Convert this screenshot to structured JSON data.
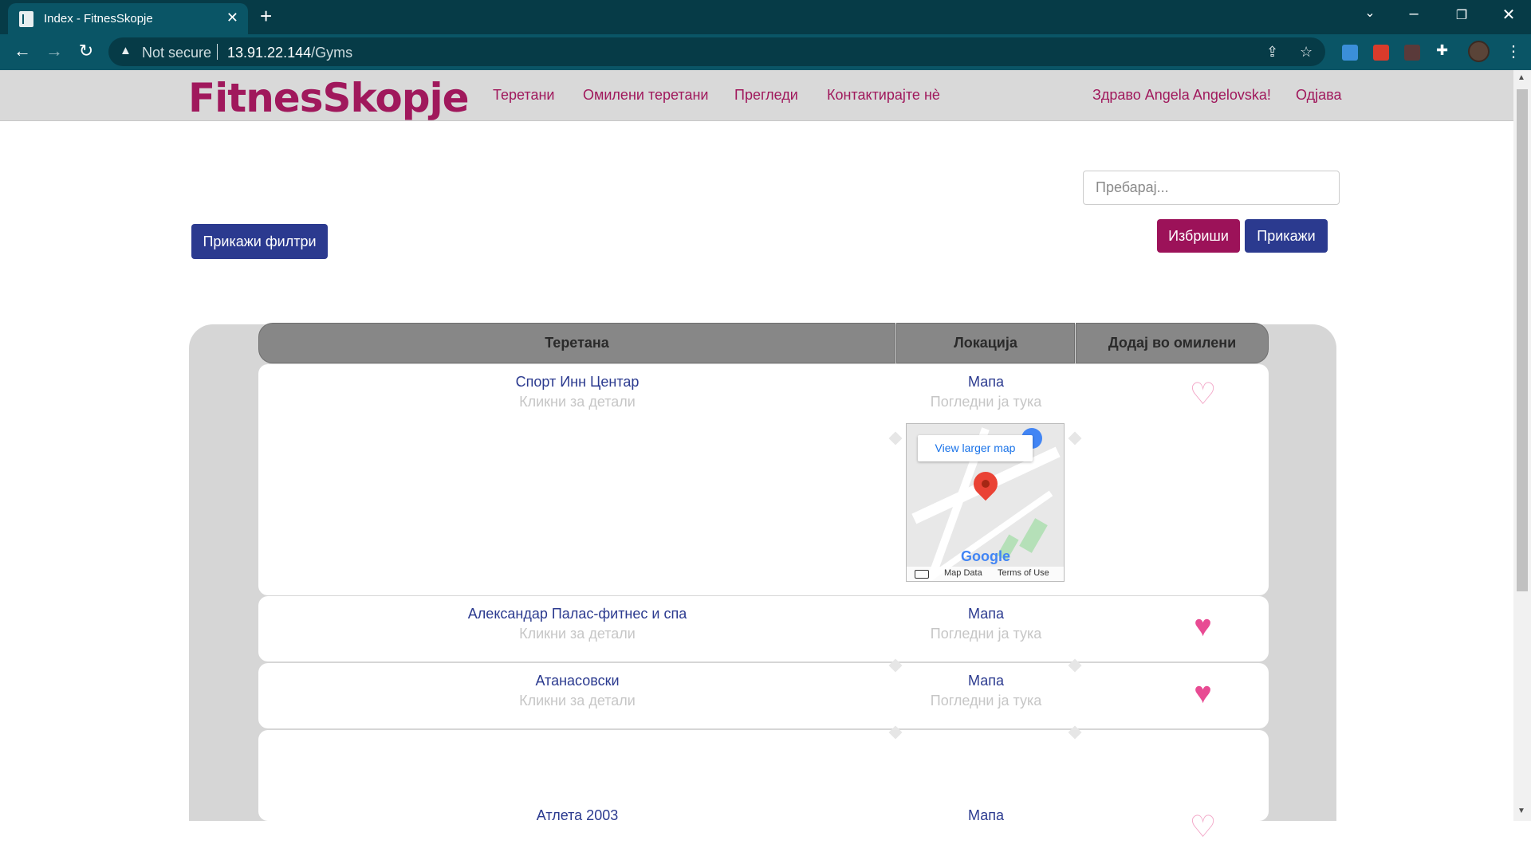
{
  "browser": {
    "tab_title": "Index - FitnesSkopje",
    "new_tab": "+",
    "close": "✕",
    "security": "Not secure",
    "url_host": "13.91.22.144",
    "url_path": "/Gyms"
  },
  "site": {
    "logo": "FitnesSkopje",
    "nav": [
      "Теретани",
      "Омилени теретани",
      "Прегледи",
      "Контактирајте нè"
    ],
    "greeting": "Здраво Angela Angelovska!",
    "logout": "Одјава"
  },
  "search": {
    "placeholder": "Пребарај...",
    "delete_label": "Избриши",
    "show_label": "Прикажи",
    "filters_label": "Прикажи филтри"
  },
  "table": {
    "headers": [
      "Теретана",
      "Локација",
      "Додај во омилени"
    ],
    "rows": [
      {
        "name": "Спорт Инн Центар",
        "details": "Кликни за детали",
        "map": "Мапа",
        "map_hint": "Погледни ја тука",
        "favorite": false
      },
      {
        "name": "Александар Палас-фитнес и спа",
        "details": "Кликни за детали",
        "map": "Мапа",
        "map_hint": "Погледни ја тука",
        "favorite": true
      },
      {
        "name": "Атанасовски",
        "details": "Кликни за детали",
        "map": "Мапа",
        "map_hint": "Погледни ја тука",
        "favorite": true
      },
      {
        "name": "Атлета 2003",
        "map": "Мапа",
        "favorite": false
      }
    ]
  },
  "map_embed": {
    "view_larger": "View larger map",
    "brand": "Google",
    "map_data": "Map Data",
    "terms": "Terms of Use"
  },
  "colors": {
    "brand": "#a0185c",
    "primary": "#2b3a8f",
    "heart": "#e84b93"
  }
}
